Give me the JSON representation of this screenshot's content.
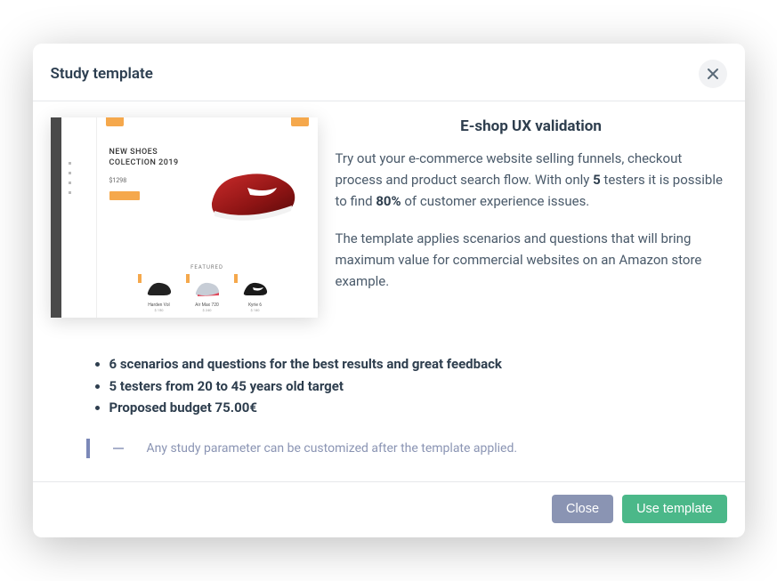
{
  "modal": {
    "title": "Study template"
  },
  "template_name": "E-shop UX validation",
  "description_p1_a": "Try out your e-commerce website selling funnels, checkout process and product search flow. With only ",
  "description_p1_bold1": "5",
  "description_p1_b": " testers it is possible to find ",
  "description_p1_bold2": "80%",
  "description_p1_c": " of customer experience issues.",
  "description_p2": "The template applies scenarios and questions that will bring maximum value for commercial websites on an Amazon store example.",
  "bullets": [
    "6 scenarios and questions for the best results and great feedback",
    "5 testers from 20 to 45 years old target",
    "Proposed budget 75.00€"
  ],
  "note": "Any study parameter can be customized after the template applied.",
  "preview": {
    "headline_a": "NEW SHOES",
    "headline_b": "COLECTION 2019",
    "price": "$1298",
    "featured_label": "FEATURED",
    "thumbs": [
      {
        "name": "Harden Vol",
        "price": "$ 150"
      },
      {
        "name": "Air Max 720",
        "price": "$ 240"
      },
      {
        "name": "Kyrie 6",
        "price": "$ 180"
      }
    ]
  },
  "buttons": {
    "close": "Close",
    "use": "Use template"
  }
}
